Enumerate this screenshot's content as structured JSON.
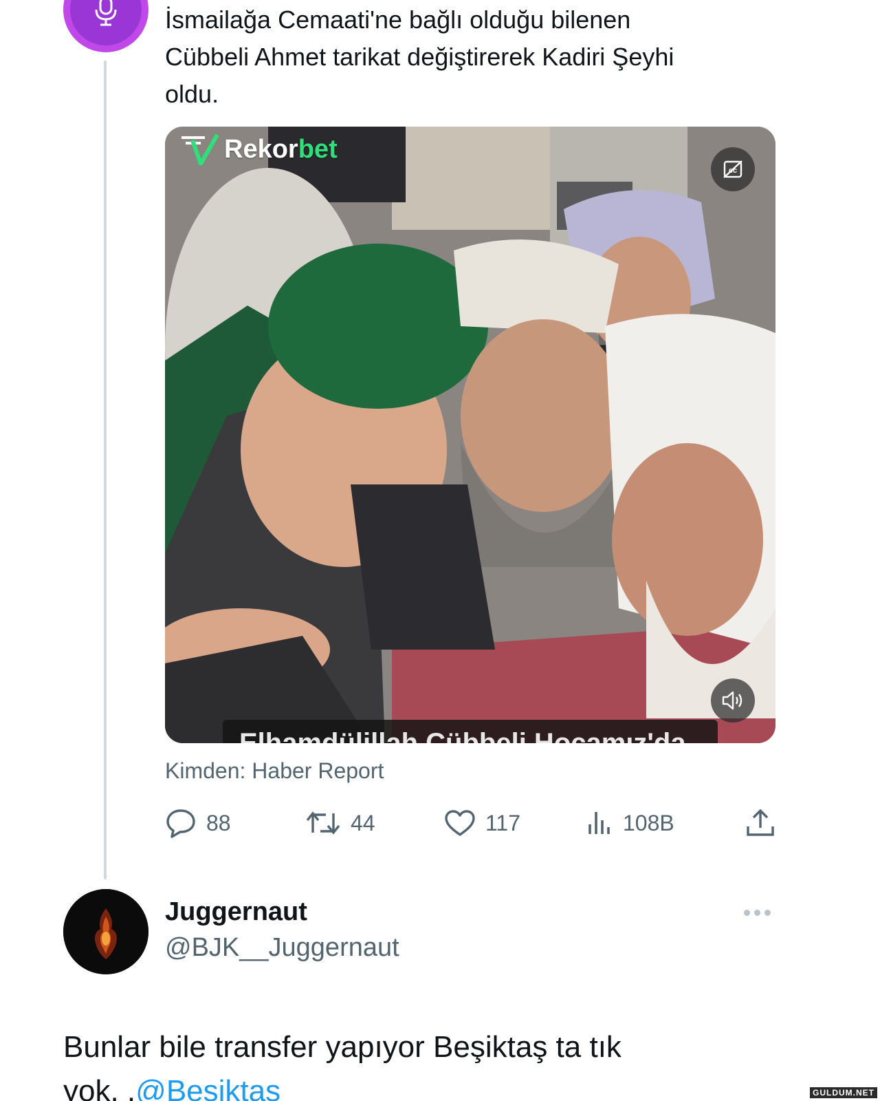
{
  "tweet": {
    "text_line1": "İsmailağa Cemaati'ne bağlı olduğu bilenen",
    "text_line2": "Cübbeli Ahmet tarikat değiştirerek Kadiri Şeyhi",
    "text_line3": "oldu.",
    "media": {
      "watermark_prefix": "Rekor",
      "watermark_suffix": "bet",
      "caption_partial": "Elhamdülillah Cübbeli Hocamız'da"
    },
    "source_label": "Kimden: Haber Report",
    "stats": {
      "replies": "88",
      "retweets": "44",
      "likes": "117",
      "views": "108B"
    }
  },
  "reply": {
    "author_name": "Juggernaut",
    "author_handle": "@BJK__Juggernaut",
    "text_main": "Bunlar bile transfer yapıyor Beşiktaş ta tık",
    "text_tail": "yok. .",
    "mention": "@Besiktas"
  },
  "site_stamp": "GULDUM.NET",
  "colors": {
    "text": "#0f1419",
    "secondary": "#536471",
    "link": "#1d9bf0",
    "avatar_purple": "#c048e8",
    "watermark_green": "#2fe07a"
  },
  "icons": [
    "microphone-icon",
    "captions-icon",
    "volume-icon",
    "reply-icon",
    "retweet-icon",
    "like-icon",
    "views-icon",
    "share-icon",
    "more-icon"
  ]
}
